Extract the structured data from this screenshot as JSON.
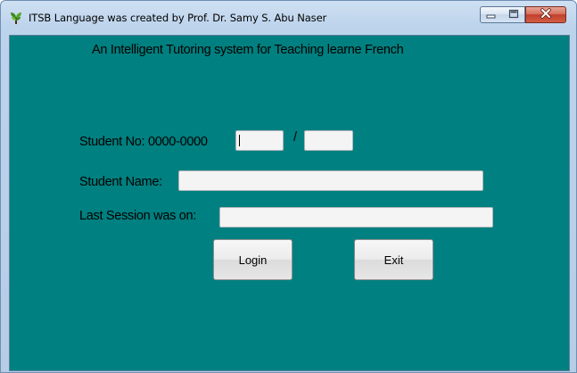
{
  "window": {
    "title": "ITSB Language was created by Prof. Dr. Samy S. Abu Naser",
    "icon": "app-plant-icon",
    "controls": {
      "minimize_icon": "minimize-icon",
      "maximize_icon": "maximize-icon",
      "close_icon": "close-icon"
    }
  },
  "form": {
    "heading": "An Intelligent Tutoring  system for  Teaching  learne French",
    "student_no_label": "Student No: 0000-0000",
    "student_no_part1_value": "",
    "separator": "/",
    "student_no_part2_value": "",
    "student_name_label": "Student Name:",
    "student_name_value": "",
    "last_session_label": "Last Session was on:",
    "last_session_value": "",
    "login_label": "Login",
    "exit_label": "Exit"
  },
  "colors": {
    "client_background": "#008080",
    "close_button": "#c13f2b",
    "titlebar": "#bcd3ec"
  }
}
